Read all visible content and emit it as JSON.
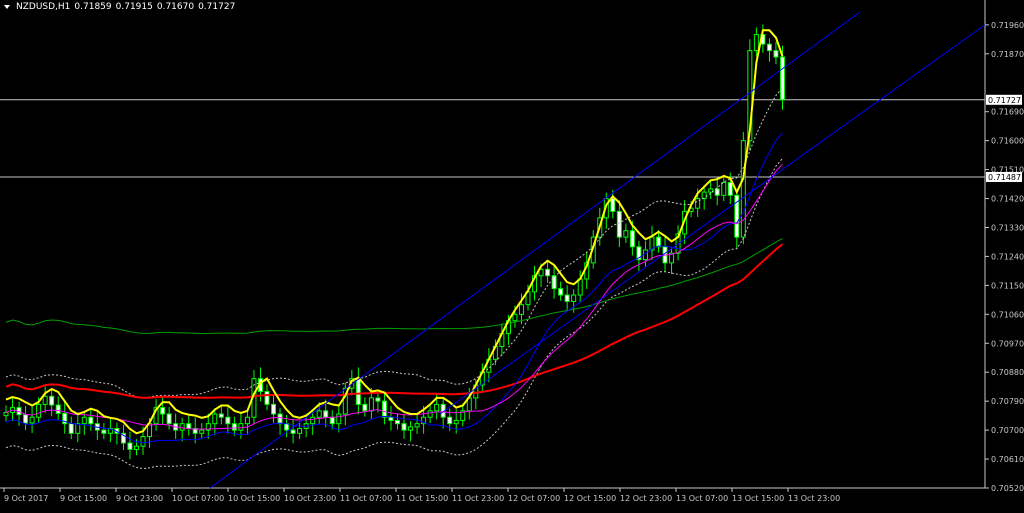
{
  "header": {
    "symbol": "NZDUSD,H1",
    "open": "0.71859",
    "high": "0.71915",
    "low": "0.71670",
    "close": "0.71727"
  },
  "colors": {
    "background": "#000000",
    "axis": "#c8c8c8",
    "bull": "#00ff00",
    "bear": "#ffffff",
    "ma_fast": "#ffff00",
    "ma_slow": "#ff0000",
    "ma_long": "#00a000",
    "ma_blue": "#0000ff",
    "ma_magenta": "#ff00ff",
    "bands": "#c8c8c8",
    "hline": "#c8c8c8"
  },
  "chart_data": {
    "type": "candlestick",
    "title": "NZDUSD,H1",
    "ylim": [
      0.7052,
      0.72
    ],
    "y_ticks": [
      "0.71960",
      "0.71870",
      "0.71690",
      "0.71600",
      "0.71510",
      "0.71420",
      "0.71330",
      "0.71240",
      "0.71150",
      "0.71060",
      "0.70970",
      "0.70880",
      "0.70790",
      "0.70700",
      "0.70610",
      "0.70520"
    ],
    "x_ticks": [
      "9 Oct 2017",
      "9 Oct 15:00",
      "9 Oct 23:00",
      "10 Oct 07:00",
      "10 Oct 15:00",
      "10 Oct 23:00",
      "11 Oct 07:00",
      "11 Oct 15:00",
      "11 Oct 23:00",
      "12 Oct 07:00",
      "12 Oct 15:00",
      "12 Oct 23:00",
      "13 Oct 07:00",
      "13 Oct 15:00",
      "13 Oct 23:00"
    ],
    "price_lines": [
      {
        "label": "0.71727",
        "value": 0.71727
      },
      {
        "label": "0.71487",
        "value": 0.71487
      }
    ],
    "grid": false,
    "close_series": [
      0.70755,
      0.7077,
      0.70748,
      0.70722,
      0.7074,
      0.7078,
      0.70805,
      0.70778,
      0.70752,
      0.7072,
      0.7069,
      0.7072,
      0.7074,
      0.7072,
      0.707,
      0.7069,
      0.70705,
      0.7069,
      0.7066,
      0.7064,
      0.7065,
      0.7068,
      0.7072,
      0.7077,
      0.7075,
      0.7072,
      0.707,
      0.7072,
      0.70705,
      0.7069,
      0.707,
      0.7072,
      0.7075,
      0.7074,
      0.7072,
      0.707,
      0.7072,
      0.7074,
      0.7086,
      0.7082,
      0.7078,
      0.7075,
      0.7072,
      0.707,
      0.7069,
      0.70705,
      0.7072,
      0.7074,
      0.7076,
      0.7074,
      0.7072,
      0.7075,
      0.7083,
      0.7086,
      0.7078,
      0.7076,
      0.708,
      0.7079,
      0.7074,
      0.7073,
      0.7072,
      0.707,
      0.7071,
      0.7072,
      0.7074,
      0.7076,
      0.7078,
      0.7074,
      0.7072,
      0.7073,
      0.7076,
      0.708,
      0.7084,
      0.7088,
      0.7092,
      0.7096,
      0.71,
      0.7104,
      0.7106,
      0.7109,
      0.7113,
      0.7118,
      0.712,
      0.7118,
      0.7114,
      0.7112,
      0.711,
      0.7112,
      0.7117,
      0.7122,
      0.713,
      0.7136,
      0.7142,
      0.7138,
      0.713,
      0.7132,
      0.7127,
      0.7123,
      0.7126,
      0.713,
      0.7127,
      0.7122,
      0.7125,
      0.7131,
      0.7138,
      0.7139,
      0.7142,
      0.7144,
      0.7145,
      0.7143,
      0.7147,
      0.7143,
      0.713,
      0.716,
      0.7188,
      0.7193,
      0.719,
      0.7188,
      0.7186,
      0.71727
    ],
    "candle_count": 120
  }
}
